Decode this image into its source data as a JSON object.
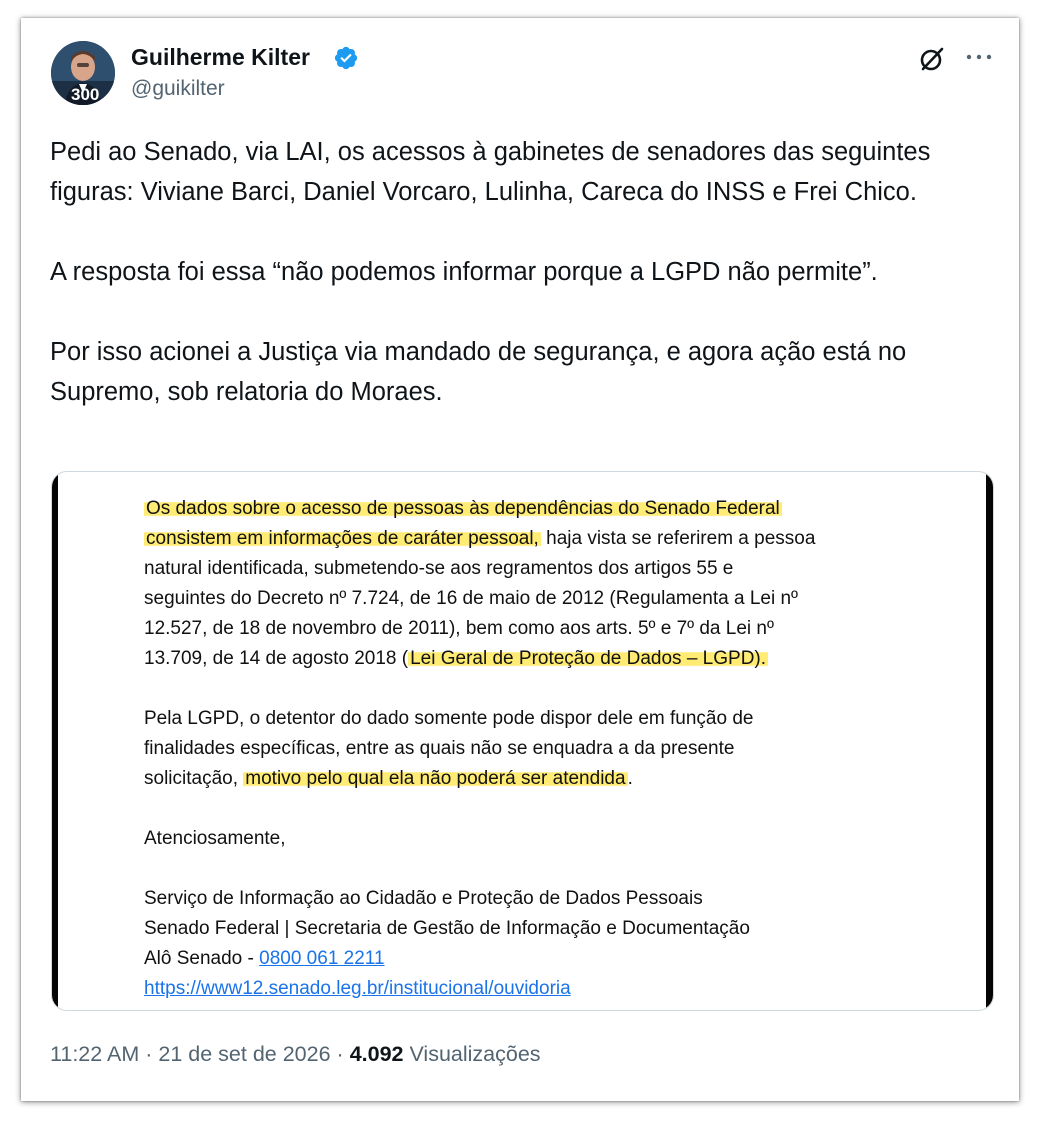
{
  "author": {
    "name": "Guilherme Kilter",
    "handle": "@guikilter",
    "avatar_badge": "300",
    "verified_icon": "verified-badge-icon"
  },
  "header_icons": {
    "grok": "grok-icon",
    "more": "more-options-icon"
  },
  "tweet": {
    "paragraphs": [
      "Pedi ao Senado, via LAI, os acessos à gabinetes de senadores das seguintes figuras: Viviane Barci, Daniel Vorcaro, Lulinha, Careca do INSS e Frei Chico.",
      "A resposta foi essa “não podemos informar porque a LGPD não permite”.",
      "Por isso acionei a Justiça via mandado de segurança, e agora ação está no Supremo, sob relatoria do Moraes."
    ]
  },
  "document": {
    "p1": {
      "l1_hl": "Os dados sobre o acesso de pessoas às dependências do Senado Federal",
      "l2_hl": "consistem em informações de caráter pessoal,",
      "l2_rest": " haja vista se referirem a pessoa",
      "l3": "natural identificada, submetendo-se aos regramentos dos artigos 55 e",
      "l4": "seguintes do Decreto nº 7.724, de 16 de maio de 2012 (Regulamenta a Lei nº",
      "l5": "12.527, de 18 de novembro de 2011), bem como aos arts. 5º e 7º da Lei nº",
      "l6_pre": "13.709, de 14 de agosto 2018 (",
      "l6_hl": "Lei Geral de Proteção de Dados – LGPD).",
      "l6_post": ""
    },
    "p2": {
      "l1": "Pela LGPD, o detentor do dado somente pode dispor dele em função de",
      "l2": "finalidades específicas, entre as quais não se enquadra a da presente",
      "l3_pre": "solicitação, ",
      "l3_hl": "motivo pelo qual ela não poderá ser atendida",
      "l3_post": "."
    },
    "closing": "Atenciosamente,",
    "signature": {
      "l1": "Serviço de Informação ao Cidadão e Proteção de Dados Pessoais",
      "l2": "Senado Federal | Secretaria de Gestão de Informação e Documentação",
      "l3_pre": "Alô Senado - ",
      "phone": "0800 061 2211",
      "url": "https://www12.senado.leg.br/institucional/ouvidoria"
    },
    "highlight_color": "#ffe85c",
    "link_color": "#1a73e8"
  },
  "meta": {
    "time": "11:22 AM",
    "date": "21 de set de 2026",
    "separator": "·",
    "views_count": "4.092",
    "views_label": "Visualizações"
  },
  "colors": {
    "text": "#0f1419",
    "secondary": "#536471",
    "verified": "#1d9bf0"
  }
}
